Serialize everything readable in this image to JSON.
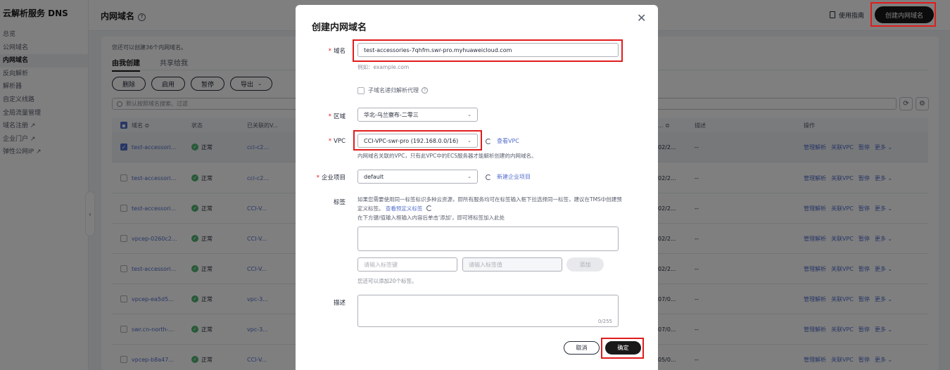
{
  "sidebar": {
    "service_title": "云解析服务 DNS",
    "items": [
      {
        "label": "总览"
      },
      {
        "label": "公网域名"
      },
      {
        "label": "内网域名"
      },
      {
        "label": "反向解析"
      },
      {
        "label": "解析器"
      },
      {
        "label": "自定义线路"
      },
      {
        "label": "全局流量管理"
      },
      {
        "label": "域名注册 ↗"
      },
      {
        "label": "企业门户 ↗"
      },
      {
        "label": "弹性公网IP ↗"
      }
    ]
  },
  "header": {
    "page_title": "内网域名",
    "help_glyph": "?",
    "guide_label": "使用指南",
    "create_label": "创建内网域名"
  },
  "content": {
    "quota_text": "您还可以创建36个内网域名。",
    "tabs": [
      {
        "label": "由我创建"
      },
      {
        "label": "共享给我"
      }
    ],
    "actions": {
      "delete": "删除",
      "enable": "启用",
      "pause": "暂停",
      "export": "导出"
    },
    "search_placeholder": "默认按照域名搜索、过滤",
    "refresh_glyph": "⟳",
    "settings_glyph": "⚙"
  },
  "table": {
    "headers": {
      "name": "域名 ⊜",
      "status": "状态",
      "vpc": "已关联的V...",
      "time": "...  ⊜",
      "desc": "描述",
      "ops": "操作"
    },
    "op_labels": {
      "manage": "管理解析",
      "associate": "关联VPC",
      "pause": "暂停",
      "more": "更多 ⌄"
    },
    "rows": [
      {
        "name": "test-accessori...",
        "status": "正常",
        "vpc": "cci-c2...",
        "time": "02/2...",
        "desc": "--"
      },
      {
        "name": "test-accessori...",
        "status": "正常",
        "vpc": "cci-c2...",
        "time": "02/2...",
        "desc": "--"
      },
      {
        "name": "test-accessori...",
        "status": "正常",
        "vpc": "CCI-V...",
        "time": "02/2...",
        "desc": "--"
      },
      {
        "name": "vpcep-0260c2...",
        "status": "正常",
        "vpc": "CCI-V...",
        "time": "02/2...",
        "desc": "--"
      },
      {
        "name": "test-accessori...",
        "status": "正常",
        "vpc": "CCI-V...",
        "time": "02/2...",
        "desc": "--"
      },
      {
        "name": "vpcep-ea5d5...",
        "status": "正常",
        "vpc": "vpc-3...",
        "time": "07/0...",
        "desc": "--"
      },
      {
        "name": "swr.cn-north-...",
        "status": "正常",
        "vpc": "vpc-3...",
        "time": "07/0...",
        "desc": "--"
      },
      {
        "name": "vpcep-b8a47...",
        "status": "正常",
        "vpc": "CCI-V...",
        "time": "05/0...",
        "desc": "--"
      }
    ]
  },
  "modal": {
    "title": "创建内网域名",
    "close_glyph": "✕",
    "required_mark": "*",
    "domain": {
      "label": "域名",
      "value": "test-accessories-7qhfm.swr-pro.myhuaweicloud.com",
      "example": "例如：example.com"
    },
    "recursive": {
      "label": "子域名递归解析代理",
      "help": "?"
    },
    "region": {
      "label": "区域",
      "value": "华北-乌兰察布-二零三"
    },
    "vpc": {
      "label": "VPC",
      "value": "CCI-VPC-swr-pro (192.168.0.0/16)",
      "view_link": "查看VPC",
      "hint": "内网域名关联的VPC，只有此VPC中的ECS服务器才能解析创建的内网域名。"
    },
    "enterprise": {
      "label": "企业项目",
      "value": "default",
      "new_link": "新建企业项目"
    },
    "tags": {
      "label": "标签",
      "desc_line1": "如果您需要使用同一标签标识多种云资源，即所有服务均可在标签输入框下拉选择同一标签，建议在TMS中创建预定义标签。",
      "predefined_link": "查看预定义标签",
      "desc_line2": "在下方键/值输入框输入内容后单击'添加'，即可将标签加入此处",
      "key_placeholder": "请输入标签键",
      "value_placeholder": "请输入标签值",
      "add_label": "添加",
      "remaining": "您还可以添加20个标签。"
    },
    "description": {
      "label": "描述",
      "counter": "0/255"
    },
    "cancel_label": "取消",
    "ok_label": "确定"
  }
}
